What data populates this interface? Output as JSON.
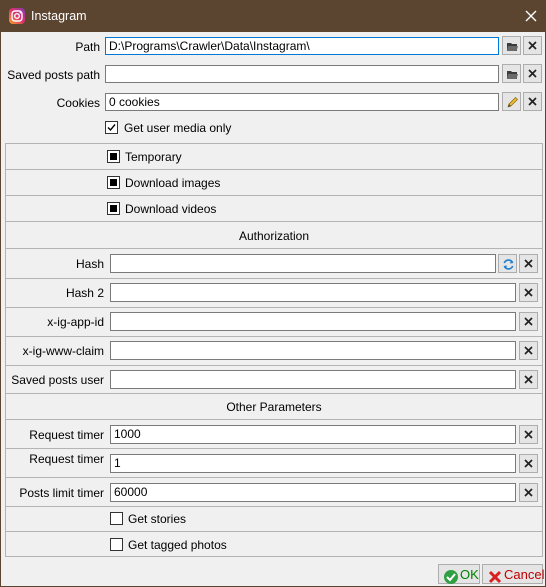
{
  "window": {
    "title": "Instagram"
  },
  "top": {
    "path": {
      "label": "Path",
      "value": "D:\\Programs\\Crawler\\Data\\Instagram\\"
    },
    "saved_posts_path": {
      "label": "Saved posts path",
      "value": ""
    },
    "cookies": {
      "label": "Cookies",
      "value": "0 cookies"
    },
    "get_user_media_only": {
      "label": "Get user media only",
      "checked": true
    }
  },
  "options": {
    "temporary": {
      "label": "Temporary",
      "state": "indeterminate"
    },
    "download_images": {
      "label": "Download images",
      "state": "indeterminate"
    },
    "download_videos": {
      "label": "Download videos",
      "state": "indeterminate"
    }
  },
  "authorization": {
    "header": "Authorization",
    "hash": {
      "label": "Hash",
      "value": ""
    },
    "hash2": {
      "label": "Hash 2",
      "value": ""
    },
    "x_ig_app_id": {
      "label": "x-ig-app-id",
      "value": ""
    },
    "x_ig_www_claim": {
      "label": "x-ig-www-claim",
      "value": ""
    },
    "saved_posts_user": {
      "label": "Saved posts user",
      "value": ""
    }
  },
  "other": {
    "header": "Other Parameters",
    "request_timer_1": {
      "label": "Request timer",
      "value": "1000"
    },
    "request_timer_2": {
      "label": "Request timer",
      "value": "1"
    },
    "posts_limit_timer": {
      "label": "Posts limit timer",
      "value": "60000"
    },
    "get_stories": {
      "label": "Get stories",
      "checked": false
    },
    "get_tagged_photos": {
      "label": "Get tagged photos",
      "checked": false
    }
  },
  "footer": {
    "ok_label": "OK",
    "cancel_label": "Cancel"
  },
  "icons": {
    "app": "instagram-icon",
    "close": "close-icon",
    "browse": "folder-open-icon",
    "clear": "clear-x-icon",
    "edit": "pencil-icon",
    "refresh": "refresh-icon",
    "ok": "check-icon",
    "cancel": "cancel-x-icon"
  },
  "colors": {
    "titlebar": "#5b4430",
    "ok_text": "#008000",
    "cancel_text": "#c00000"
  }
}
